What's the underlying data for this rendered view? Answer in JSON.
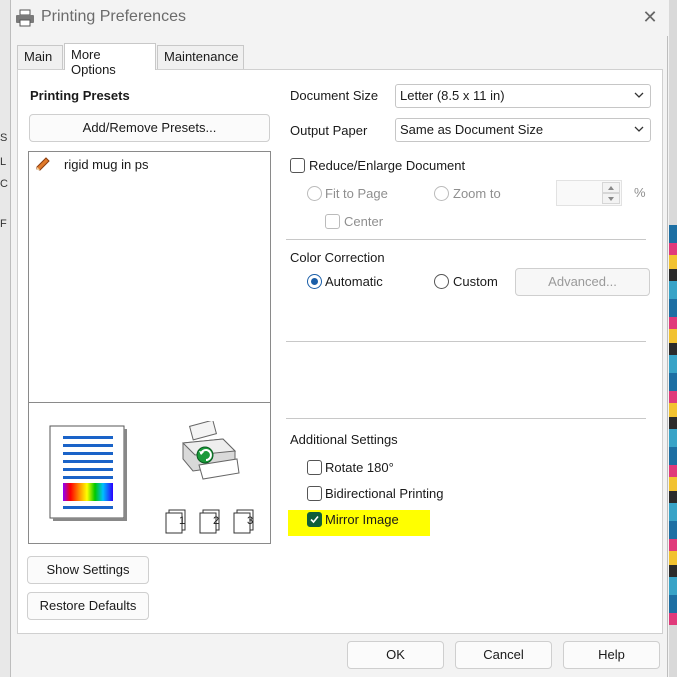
{
  "window": {
    "title": "Printing Preferences",
    "close_icon": "close-icon"
  },
  "tabs": [
    {
      "label": "Main"
    },
    {
      "label": "More Options"
    },
    {
      "label": "Maintenance"
    }
  ],
  "presets": {
    "heading": "Printing Presets",
    "add_remove_button": "Add/Remove Presets...",
    "items": [
      {
        "label": "rigid mug in ps",
        "icon": "preset-pencil-icon"
      }
    ]
  },
  "preview": {
    "page_icon": "page-preview-icon",
    "printer_icon": "printer-preview-icon",
    "copies_icons": [
      "1",
      "2",
      "3"
    ]
  },
  "left_buttons": {
    "show_settings": "Show Settings",
    "restore_defaults": "Restore Defaults"
  },
  "document_size": {
    "label": "Document Size",
    "value": "Letter (8.5 x 11 in)"
  },
  "output_paper": {
    "label": "Output Paper",
    "value": "Same as Document Size"
  },
  "reduce_enlarge": {
    "label": "Reduce/Enlarge Document",
    "checked": false,
    "fit_to_page": "Fit to Page",
    "zoom_to": "Zoom to",
    "zoom_value": "",
    "percent": "%",
    "center": "Center"
  },
  "color_correction": {
    "heading": "Color Correction",
    "automatic": "Automatic",
    "custom": "Custom",
    "advanced_button": "Advanced...",
    "selected": "Automatic"
  },
  "additional_settings": {
    "heading": "Additional Settings",
    "rotate": {
      "label": "Rotate 180°",
      "checked": false
    },
    "bidirectional": {
      "label": "Bidirectional Printing",
      "checked": false
    },
    "mirror": {
      "label": "Mirror Image",
      "checked": true
    },
    "highlight_color": "#ffff00"
  },
  "footer": {
    "ok": "OK",
    "cancel": "Cancel",
    "help": "Help"
  },
  "background": {
    "left_fragments": [
      "S",
      "L",
      "C",
      "F"
    ]
  }
}
